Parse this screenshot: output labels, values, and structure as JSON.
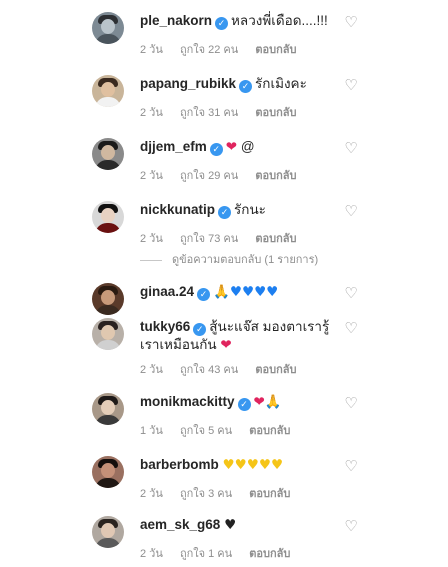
{
  "comments": [
    {
      "username": "ple_nakorn",
      "verified": true,
      "text": "หลวงพี่เดือด....!!!",
      "age": "2 วัน",
      "likes": "ถูกใจ 22 คน",
      "reply": "ตอบกลับ"
    },
    {
      "username": "papang_rubikk",
      "verified": true,
      "text": "รักเมิงคะ",
      "age": "2 วัน",
      "likes": "ถูกใจ 31 คน",
      "reply": "ตอบกลับ"
    },
    {
      "username": "djjem_efm",
      "verified": true,
      "text": "@",
      "age": "2 วัน",
      "likes": "ถูกใจ 29 คน",
      "reply": "ตอบกลับ",
      "emoji": [
        "red-heart"
      ]
    },
    {
      "username": "nickkunatip",
      "verified": true,
      "text": "รักนะ",
      "age": "2 วัน",
      "likes": "ถูกใจ 73 คน",
      "reply": "ตอบกลับ",
      "view_replies": "ดูข้อความตอบกลับ (1 รายการ)"
    },
    {
      "username": "ginaa.24",
      "verified": true,
      "text": "",
      "emoji": [
        "folded-hands",
        "blue-heart",
        "blue-heart",
        "blue-heart",
        "blue-heart"
      ]
    },
    {
      "username": "tukky66",
      "verified": true,
      "text": "สู้นะแจ๊ส มองตาเรารู้ เราเหมือนกัน",
      "age": "2 วัน",
      "likes": "ถูกใจ 43 คน",
      "reply": "ตอบกลับ",
      "emoji": [
        "red-heart"
      ]
    },
    {
      "username": "monikmackitty",
      "verified": true,
      "text": "",
      "age": "1 วัน",
      "likes": "ถูกใจ 5 คน",
      "reply": "ตอบกลับ",
      "emoji": [
        "red-heart",
        "folded-hands"
      ]
    },
    {
      "username": "barberbomb",
      "verified": false,
      "text": "",
      "age": "2 วัน",
      "likes": "ถูกใจ 3 คน",
      "reply": "ตอบกลับ",
      "emoji": [
        "yellow-heart",
        "yellow-heart",
        "yellow-heart",
        "yellow-heart",
        "yellow-heart"
      ]
    },
    {
      "username": "aem_sk_g68",
      "verified": false,
      "text": "",
      "age": "2 วัน",
      "likes": "ถูกใจ 1 คน",
      "reply": "ตอบกลับ",
      "emoji": [
        "black-heart"
      ]
    }
  ],
  "icons": {
    "verified": "verified-badge-icon",
    "like": "heart-outline-icon"
  },
  "colors": {
    "verified": "#3897f0",
    "meta": "#8e8e8e",
    "text": "#262626"
  }
}
